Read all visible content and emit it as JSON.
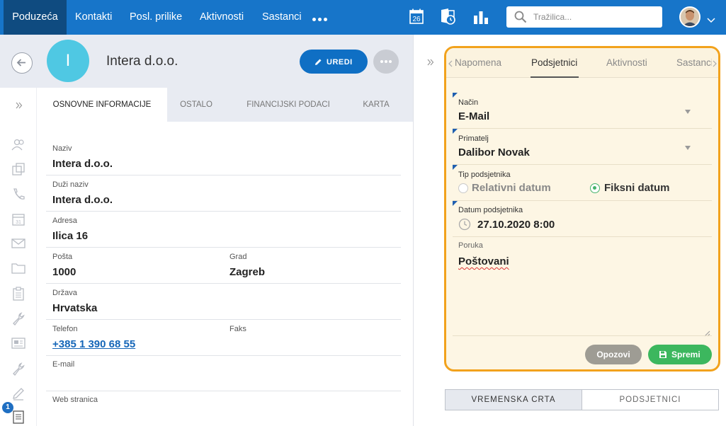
{
  "nav": {
    "items": [
      "Poduzeća",
      "Kontakti",
      "Posl. prilike",
      "Aktivnosti",
      "Sastanci"
    ],
    "calendar_day": "26",
    "search_placeholder": "Tražilica...",
    "accent_color": "#1775c9"
  },
  "company": {
    "initial": "I",
    "name": "Intera d.o.o.",
    "edit_label": "UREDI"
  },
  "tabs": [
    "OSNOVNE INFORMACIJE",
    "OSTALO",
    "FINANCIJSKI PODACI",
    "KARTA"
  ],
  "fields": {
    "naziv_label": "Naziv",
    "naziv_value": "Intera d.o.o.",
    "duzi_label": "Duži naziv",
    "duzi_value": "Intera d.o.o.",
    "adresa_label": "Adresa",
    "adresa_value": "Ilica 16",
    "posta_label": "Pošta",
    "posta_value": "1000",
    "grad_label": "Grad",
    "grad_value": "Zagreb",
    "drzava_label": "Država",
    "drzava_value": "Hrvatska",
    "telefon_label": "Telefon",
    "telefon_value": "+385 1 390 68 55",
    "faks_label": "Faks",
    "email_label": "E-mail",
    "web_label": "Web stranica"
  },
  "sidebar_badge": "1",
  "reminder": {
    "tabs": [
      "Napomena",
      "Podsjetnici",
      "Aktivnosti",
      "Sastanci"
    ],
    "nacin_label": "Način",
    "nacin_value": "E-Mail",
    "primatelj_label": "Primatelj",
    "primatelj_value": "Dalibor Novak",
    "tip_label": "Tip podsjetnika",
    "tip_option_1": "Relativni datum",
    "tip_option_2": "Fiksni datum",
    "datum_label": "Datum podsjetnika",
    "datum_value": "27.10.2020 8:00",
    "poruka_label": "Poruka",
    "poruka_value": "Poštovani",
    "cancel_label": "Opozovi",
    "save_label": "Spremi",
    "highlight_color": "#f2a21c"
  },
  "bottom_tabs": [
    "VREMENSKA CRTA",
    "PODSJETNICI"
  ]
}
